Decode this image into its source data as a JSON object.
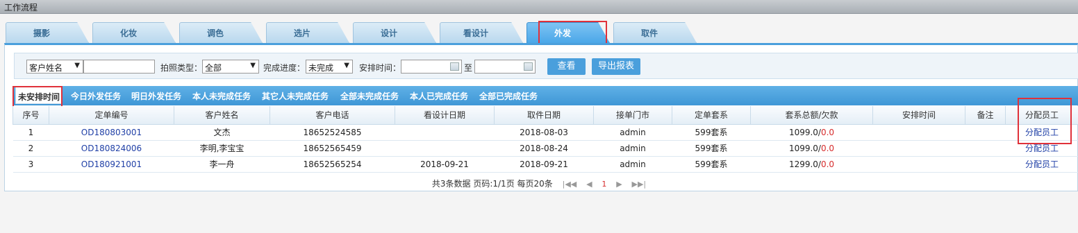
{
  "window": {
    "title": "工作流程"
  },
  "tabs": [
    {
      "label": "摄影"
    },
    {
      "label": "化妆"
    },
    {
      "label": "调色"
    },
    {
      "label": "选片"
    },
    {
      "label": "设计"
    },
    {
      "label": "看设计"
    },
    {
      "label": "外发"
    },
    {
      "label": "取件"
    }
  ],
  "active_tab": "外发",
  "filter": {
    "name_type": "客户姓名",
    "name_value": "",
    "photo_type_label": "拍照类型：",
    "photo_type_value": "全部",
    "progress_label": "完成进度：",
    "progress_value": "未完成",
    "time_label": "安排时间：",
    "to_label": "至",
    "start_date": "",
    "end_date": "",
    "view_button": "查看",
    "export_button": "导出报表"
  },
  "subtabs": [
    {
      "label": "未安排时间"
    },
    {
      "label": "今日外发任务"
    },
    {
      "label": "明日外发任务"
    },
    {
      "label": "本人未完成任务"
    },
    {
      "label": "其它人未完成任务"
    },
    {
      "label": "全部未完成任务"
    },
    {
      "label": "本人已完成任务"
    },
    {
      "label": "全部已完成任务"
    }
  ],
  "table": {
    "headers": [
      "序号",
      "定单编号",
      "客户姓名",
      "客户电话",
      "看设计日期",
      "取件日期",
      "接单门市",
      "定单套系",
      "套系总额/欠款",
      "安排时间",
      "备注",
      "分配员工"
    ],
    "rows": [
      {
        "no": "1",
        "order": "OD180803001",
        "name": "文杰",
        "phone": "18652524585",
        "design_date": "",
        "pickup_date": "2018-08-03",
        "store": "admin",
        "package": "599套系",
        "total": "1099.0/",
        "owe": "0.0",
        "time": "",
        "note": "",
        "action": "分配员工"
      },
      {
        "no": "2",
        "order": "OD180824006",
        "name": "李明,李宝宝",
        "phone": "18652565459",
        "design_date": "",
        "pickup_date": "2018-08-24",
        "store": "admin",
        "package": "599套系",
        "total": "1099.0/",
        "owe": "0.0",
        "time": "",
        "note": "",
        "action": "分配员工"
      },
      {
        "no": "3",
        "order": "OD180921001",
        "name": "李一舟",
        "phone": "18652565254",
        "design_date": "2018-09-21",
        "pickup_date": "2018-09-21",
        "store": "admin",
        "package": "599套系",
        "total": "1299.0/",
        "owe": "0.0",
        "time": "",
        "note": "",
        "action": "分配员工"
      }
    ]
  },
  "pager": {
    "summary": "共3条数据 页码:1/1页 每页20条",
    "current_page": "1"
  },
  "colors": {
    "accent": "#4a9fdc",
    "highlight": "#e0313a",
    "link": "#1f3fa6",
    "owe": "#d62b2b"
  }
}
